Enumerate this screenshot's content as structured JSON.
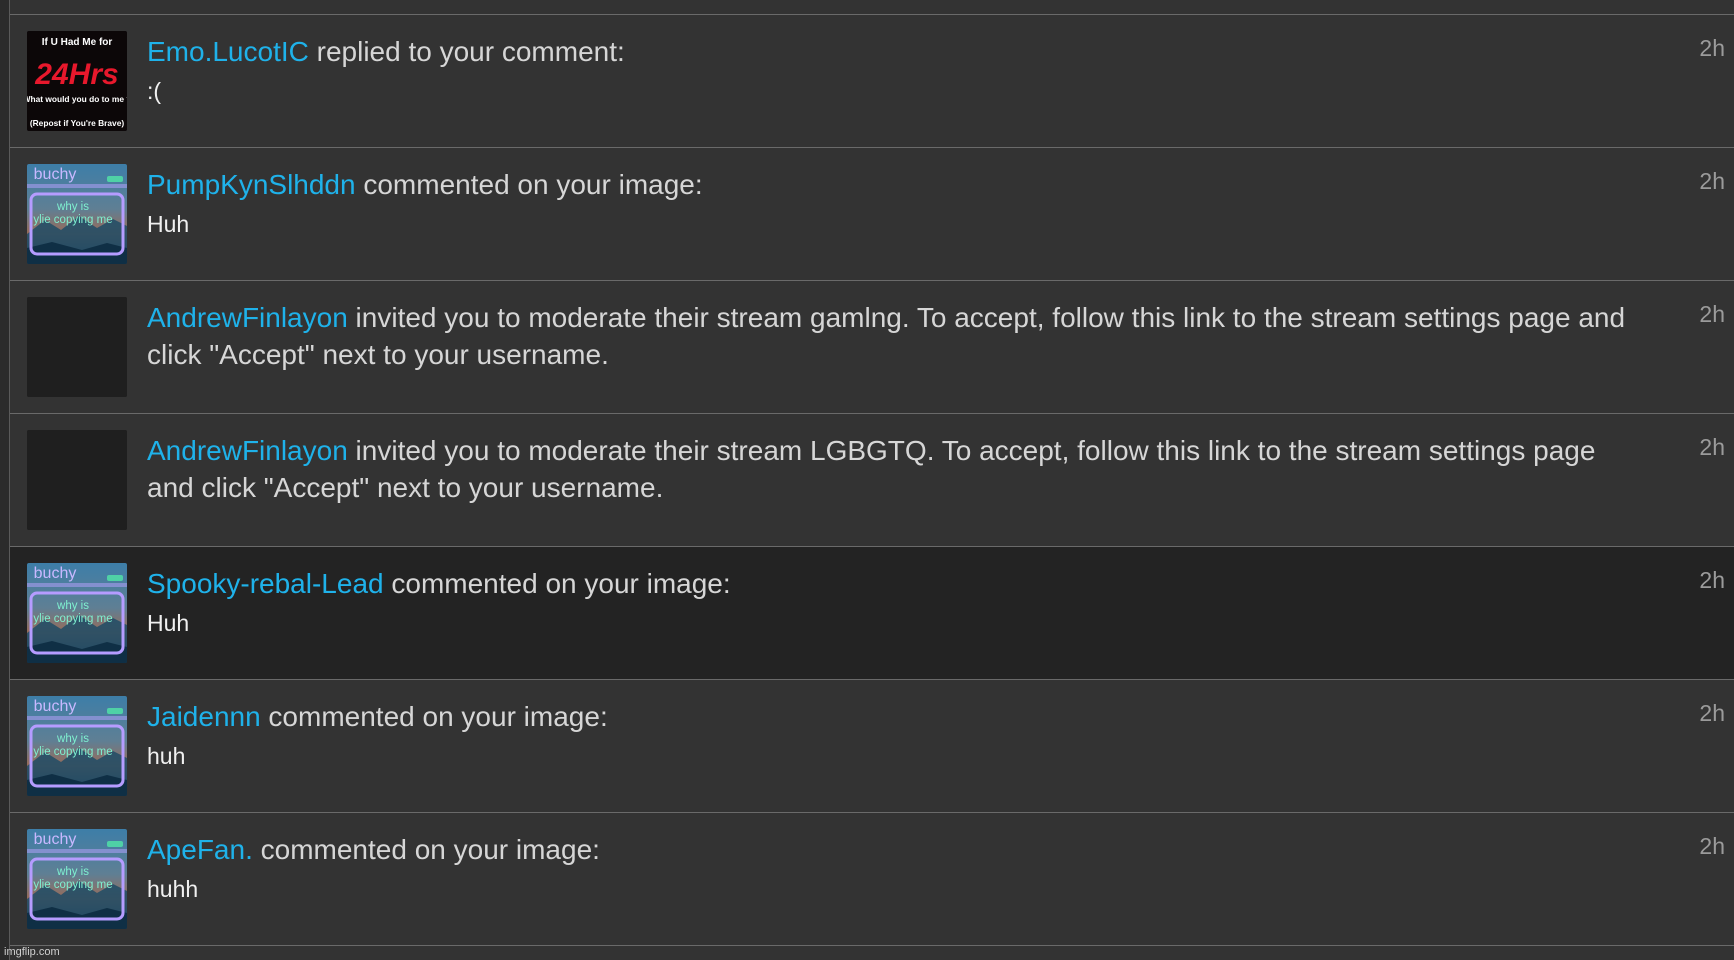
{
  "notifications": [
    {
      "username": "Emo.LucotIC",
      "action": " replied to your comment:",
      "comment": ":(",
      "time": "2h",
      "avatar": "dare-meme",
      "avatar_text": [
        "If U Had Me for",
        "24Hrs",
        "What would you do to me ?",
        "(Repost if You're Brave)"
      ]
    },
    {
      "username": "PumpKynSlhddn",
      "action": " commented on your image:",
      "comment": "Huh",
      "time": "2h",
      "avatar": "screenshot-meme",
      "avatar_text": [
        "buchy",
        "why is",
        "ylie copying me"
      ]
    },
    {
      "username": "AndrewFinlayon",
      "action": " invited you to moderate their stream gamlng. To accept, follow this link to the stream settings page and click \"Accept\" next to your username.",
      "comment": "",
      "time": "2h",
      "avatar": "blank",
      "avatar_text": []
    },
    {
      "username": "AndrewFinlayon",
      "action": " invited you to moderate their stream LGBGTQ. To accept, follow this link to the stream settings page and click \"Accept\" next to your username.",
      "comment": "",
      "time": "2h",
      "avatar": "blank",
      "avatar_text": []
    },
    {
      "username": "Spooky-rebal-Lead",
      "action": " commented on your image:",
      "comment": "Huh",
      "time": "2h",
      "avatar": "screenshot-meme",
      "avatar_text": [
        "buchy",
        "why is",
        "ylie copying me"
      ],
      "highlight": true
    },
    {
      "username": "Jaidennn",
      "action": " commented on your image:",
      "comment": "huh",
      "time": "2h",
      "avatar": "screenshot-meme",
      "avatar_text": [
        "buchy",
        "why is",
        "ylie copying me"
      ]
    },
    {
      "username": "ApeFan.",
      "action": " commented on your image:",
      "comment": "huhh",
      "time": "2h",
      "avatar": "screenshot-meme",
      "avatar_text": [
        "buchy",
        "why is",
        "ylie copying me"
      ]
    }
  ],
  "watermark": "imgflip.com",
  "colors": {
    "username": "#1fb2ea",
    "background": "#333333",
    "highlight_background": "#232323",
    "divider": "#6a6a6a"
  }
}
